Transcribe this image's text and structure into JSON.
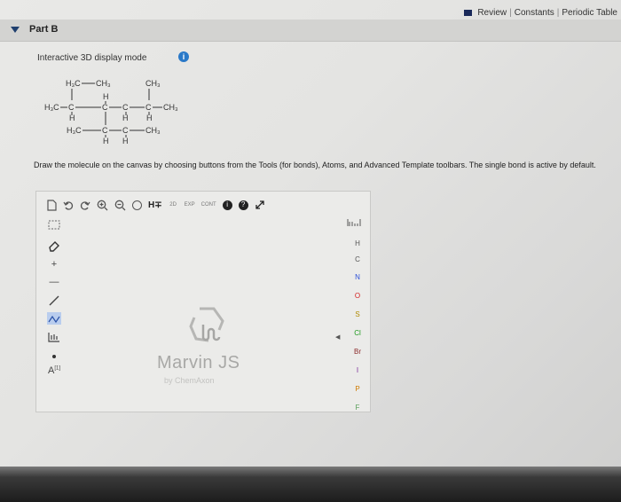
{
  "top_links": {
    "review": "Review",
    "sep1": "|",
    "constants": "Constants",
    "sep2": "|",
    "periodic": "Periodic Table"
  },
  "part": {
    "title": "Part B"
  },
  "display_mode": {
    "label": "Interactive 3D display mode"
  },
  "molecule": {
    "r1_left": "H₃C",
    "r1_right": "CH₃",
    "r1_ch3": "CH₃",
    "r2_h3c": "H₃C",
    "r2_c1": "C",
    "r2_c2": "C",
    "r2_c3": "C",
    "r2_c4": "C",
    "r2_ch3": "CH₃",
    "h_top": "H",
    "h1": "H",
    "h2": "H",
    "h3": "H",
    "h4": "H",
    "r3_h3c": "H₃C",
    "r3_c1": "C",
    "r3_c2": "C",
    "r3_ch3": "CH₃"
  },
  "instructions": {
    "text": "Draw the molecule on the canvas by choosing buttons from the Tools (for bonds), Atoms, and Advanced Template toolbars. The single bond is active by default."
  },
  "toolbar": {
    "h_label": "H∓",
    "ch_label": "2D",
    "exp_label": "EXP",
    "cont_label": "CONT",
    "help_label": "?"
  },
  "left_tools": [
    "+",
    "—",
    "A"
  ],
  "atoms": [
    "H",
    "C",
    "N",
    "O",
    "S",
    "Cl",
    "Br",
    "I",
    "P",
    "F"
  ],
  "atom_colors": {
    "H": "#555555",
    "C": "#555555",
    "N": "#2b4fd8",
    "O": "#d42020",
    "S": "#b08a00",
    "Cl": "#1d9a1d",
    "Br": "#8a2a2a",
    "I": "#7a2a9a",
    "P": "#d07a00",
    "F": "#5aa05a"
  },
  "logo": {
    "name": "Marvin JS",
    "by": "by ChemAxon"
  }
}
